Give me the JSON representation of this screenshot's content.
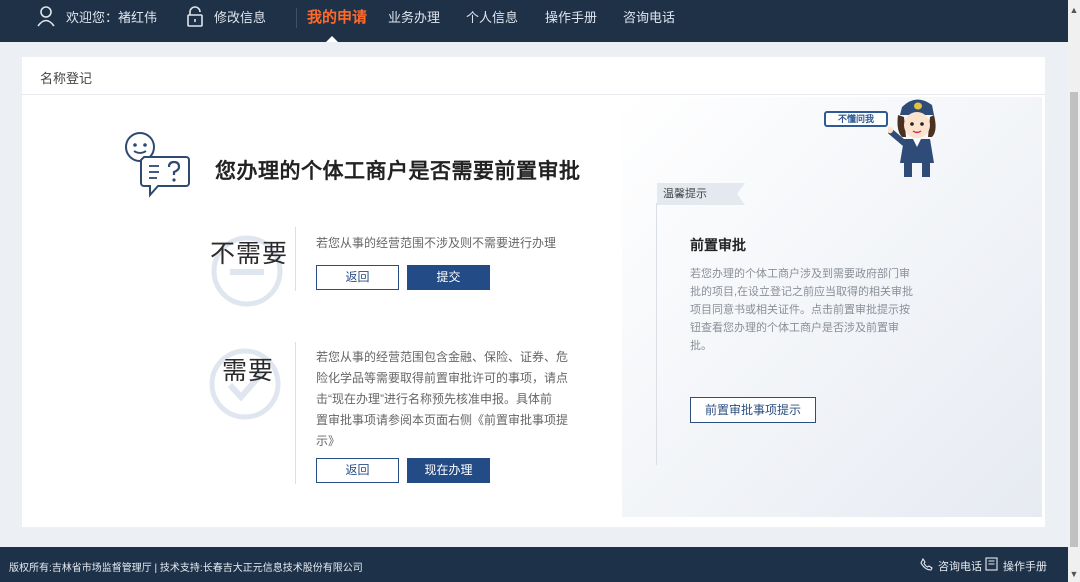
{
  "nav": {
    "welcome": "欢迎您：褚红伟",
    "edit_info": "修改信息",
    "items": [
      "我的申请",
      "业务办理",
      "个人信息",
      "操作手册",
      "咨询电话"
    ]
  },
  "breadcrumb": "名称登记",
  "main": {
    "title": "您办理的个体工商户是否需要前置审批",
    "no_need": {
      "label": "不需要",
      "desc": "若您从事的经营范围不涉及则不需要进行办理",
      "back_label": "返回",
      "submit_label": "提交"
    },
    "need": {
      "label": "需要",
      "desc_lines": [
        "若您从事的经营范围包含金融、保险、证券、危",
        "险化学品等需要取得前置审批许可的事项，请点",
        "击“现在办理”进行名称预先核准申报。具体前",
        "置审批事项请参阅本页面右侧《前置审批事项提",
        "示》"
      ],
      "back_label": "返回",
      "do_now_label": "现在办理"
    }
  },
  "tips": {
    "tag": "温馨提示",
    "title": "前置审批",
    "text_lines": [
      "若您办理的个体工商户涉及到需要政府部门审",
      "批的项目,在设立登记之前应当取得的相关审批",
      "项目同意书或相关证件。点击前置审批提示按",
      "钮查看您办理的个体工商户是否涉及前置审",
      "批。"
    ],
    "button_label": "前置审批事项提示",
    "mascot_bubble": "不懂问我"
  },
  "footer": {
    "copyright": "版权所有:吉林省市场监督管理厅 | 技术支持:长春吉大正元信息技术股份有限公司",
    "phone_label": "咨询电话",
    "manual_label": "操作手册"
  },
  "colors": {
    "nav_bg": "#1e3147",
    "active": "#ff6a2a",
    "primary_button": "#234b85",
    "footer_bg": "#1d3148"
  },
  "icons": [
    "user-icon",
    "lock-icon",
    "question-chat-icon",
    "minus-circle-icon",
    "check-circle-icon",
    "phone-icon",
    "manual-icon"
  ]
}
